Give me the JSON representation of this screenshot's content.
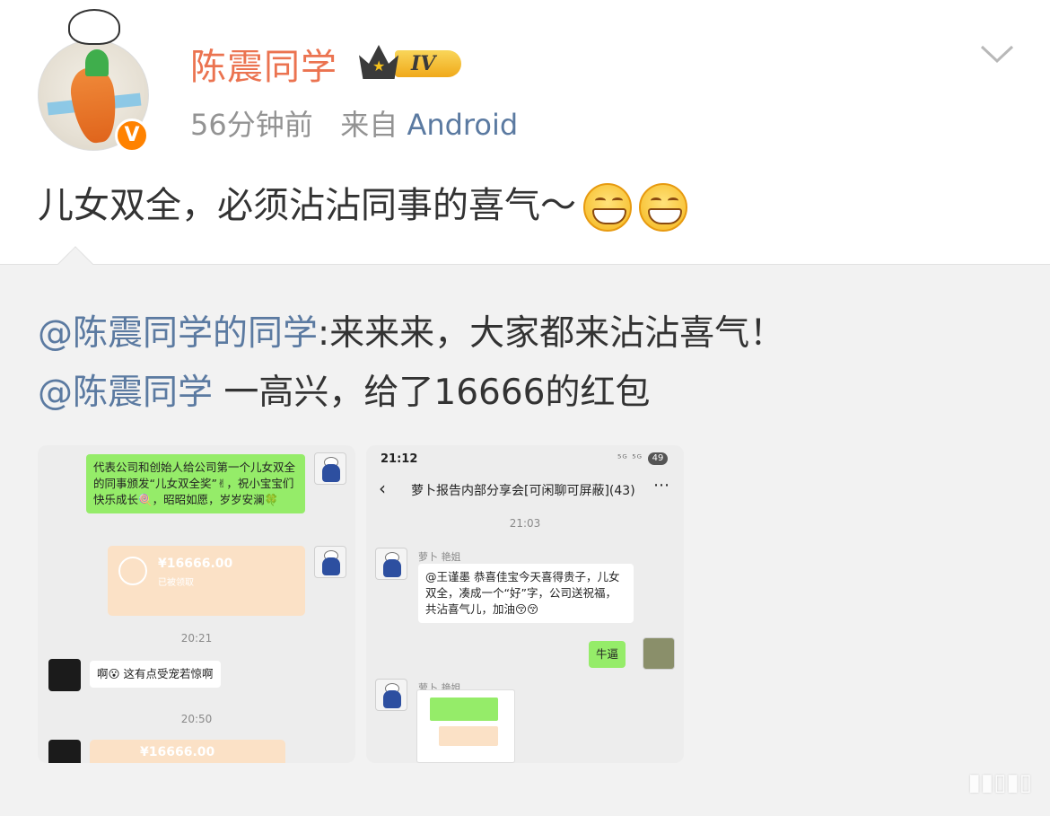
{
  "post": {
    "username": "陈震同学",
    "level_badge": "IV",
    "verified_badge": "V",
    "time": "56分钟前",
    "source_prefix": "来自",
    "source": "Android",
    "text": "儿女双全，必须沾沾同事的喜气～"
  },
  "retweet": {
    "line1_mention": "@陈震同学的同学",
    "line1_text": ":来来来，大家都来沾沾喜气！",
    "line2_mention": "@陈震同学",
    "line2_text": " 一高兴，给了16666的红包"
  },
  "screenshot1": {
    "message": "代表公司和创始人给公司第一个儿女双全的同事颁发“儿女双全奖”✌，祝小宝宝们快乐成长🍭，昭昭如愿，岁岁安澜🍀",
    "red_packet_amount": "¥16666.00",
    "red_packet_status": "已被领取",
    "time1": "20:21",
    "reply": "啊😮 这有点受宠若惊啊",
    "time2": "20:50",
    "red_packet_amount_2": "¥16666.00"
  },
  "screenshot2": {
    "status_time": "21:12",
    "battery": "49",
    "signal_text": "⁵ᴳ ⁵ᴳ",
    "chat_title": "萝卜报告内部分享会[可闲聊可屏蔽](43)",
    "time": "21:03",
    "sender1": "萝卜 艳姐",
    "message1": "@王谨墨  恭喜佳宝今天喜得贵子，儿女双全，凑成一个“好”字，公司送祝福，共沾喜气儿，加油😚😚",
    "reply": "牛逼",
    "sender2": "萝卜 艳姐"
  },
  "colors": {
    "username": "#eb7350",
    "mention": "#5b7aa1",
    "meta": "#939393",
    "retweet_bg": "#f2f2f2",
    "wechat_green": "#95ec69"
  },
  "icons": [
    "verified-v-icon",
    "crown-level-icon",
    "chevron-down-icon",
    "grin-emoji-icon"
  ]
}
